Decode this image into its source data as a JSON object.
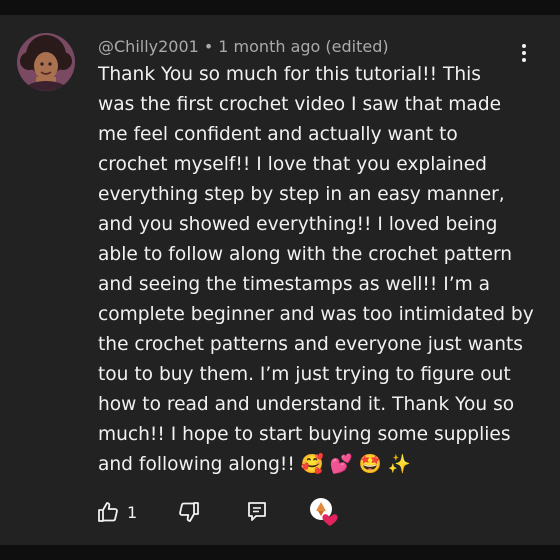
{
  "comment": {
    "author": "@Chilly2001",
    "separator": "•",
    "time": "1 month ago (edited)",
    "lines": [
      "Thank You so much for this tutorial!! This",
      "was the first crochet video I saw that made",
      "me feel confident and actually want to",
      "crochet myself!! I love that you explained",
      "everything step by step in an easy manner,",
      "and you showed everything!! I loved being",
      "able to follow along with the crochet pattern",
      "and seeing the timestamps as well!! I’m a",
      "complete beginner and was too intimidated by",
      "the crochet patterns and everyone just wants",
      "tou to buy them. I’m just trying to figure out",
      "how to read and understand it. Thank You so",
      "much!! I hope to start buying some supplies",
      "and following along!! 🥰 💕 🤩 ✨"
    ]
  },
  "actions": {
    "like_count": "1"
  },
  "icons": {
    "menu": "more-vert-icon",
    "like": "thumb-up-icon",
    "dislike": "thumb-down-icon",
    "reply": "reply-comment-icon",
    "creator_heart": "creator-heart-icon"
  },
  "colors": {
    "background": "#0f0f0f",
    "card": "#222222",
    "text_primary": "#f1f1f1",
    "text_secondary": "#aaaaaa",
    "heart": "#e0245e"
  }
}
